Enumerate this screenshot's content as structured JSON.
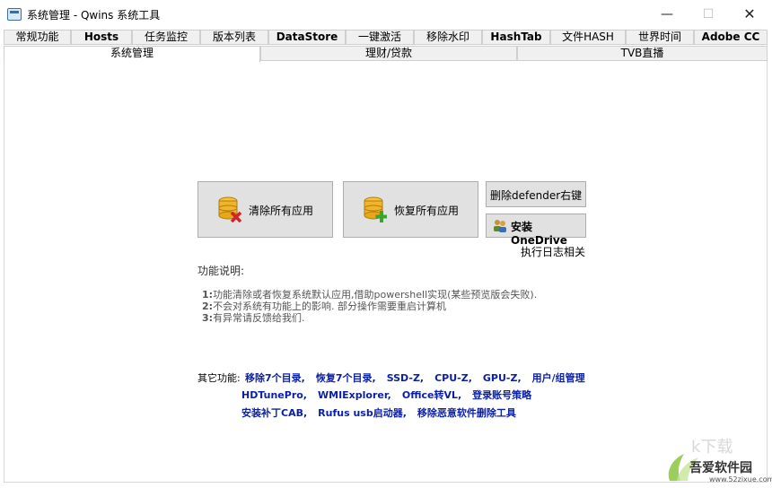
{
  "window": {
    "title": "系统管理 - Qwins 系统工具",
    "minimize": "—",
    "maximize": "☐",
    "close": "✕"
  },
  "tabs_row1": [
    {
      "label": "常规功能",
      "bold": false
    },
    {
      "label": "Hosts",
      "bold": true
    },
    {
      "label": "任务监控",
      "bold": false
    },
    {
      "label": "版本列表",
      "bold": false
    },
    {
      "label": "DataStore",
      "bold": true
    },
    {
      "label": "一键激活",
      "bold": false
    },
    {
      "label": "移除水印",
      "bold": false
    },
    {
      "label": "HashTab",
      "bold": true
    },
    {
      "label": "文件HASH",
      "bold": false
    },
    {
      "label": "世界时间",
      "bold": false
    },
    {
      "label": "Adobe CC",
      "bold": true
    }
  ],
  "tabs_row2": [
    {
      "label": "系统管理",
      "active": true
    },
    {
      "label": "理财/贷款",
      "active": false
    },
    {
      "label": "TVB直播",
      "active": false
    }
  ],
  "buttons": {
    "clear_apps": "清除所有应用",
    "restore_apps": "恢复所有应用",
    "remove_defender": "删除defender右键",
    "install_onedrive": "安装OneDrive"
  },
  "log_link": "执行日志相关",
  "description": {
    "title": "功能说明:",
    "lines": [
      {
        "num": "1:",
        "text": "功能清除或者恢复系统默认应用,借助powershell实现(某些预览版会失败)."
      },
      {
        "num": "2:",
        "text": "不会对系统有功能上的影响. 部分操作需要重启计算机"
      },
      {
        "num": "3:",
        "text": "有异常请反馈给我们."
      }
    ]
  },
  "other": {
    "label": "其它功能:",
    "row1": [
      "移除7个目录,",
      "恢复7个目录,",
      "SSD-Z,",
      "CPU-Z,",
      "GPU-Z,",
      "用户/组管理"
    ],
    "row2": [
      "HDTunePro,",
      "WMIExplorer,",
      "Office转VL,",
      "登录账号策略"
    ],
    "row3": [
      "安装补丁CAB,",
      "Rufus usb启动器,",
      "移除恶意软件删除工具"
    ]
  },
  "watermark": {
    "text": "吾爱软件园",
    "url": "www.52zixue.com"
  }
}
